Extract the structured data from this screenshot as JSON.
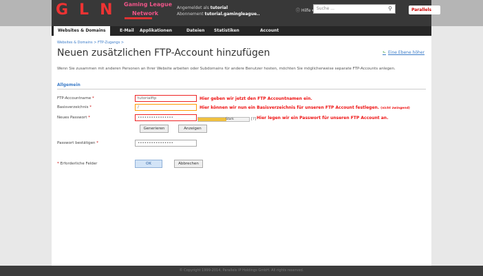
{
  "header": {
    "logo": "GLN",
    "logo_sub1": "Gaming League",
    "logo_sub2": "Network",
    "login_prefix": "Angemeldet als",
    "login_user": "tutorial",
    "login_sub_prefix": "Abonnement",
    "login_sub": "tutorial.gamingleague..",
    "help": "Hilfe",
    "search_placeholder": "Suche ...",
    "parallels": "Parallels"
  },
  "tabs": [
    "Websites & Domains",
    "E-Mail",
    "Applikationen",
    "Dateien",
    "Statistiken",
    "Account"
  ],
  "breadcrumb": "Websites & Domains > FTP-Zugangs >",
  "title": "Neuen zusätzlichen FTP-Account hinzufügen",
  "help_link": "Eine Ebene höher",
  "description": "Wenn Sie zusammen mit anderen Personen an Ihrer Website arbeiten oder Subdomains für andere Benutzer hosten, möchten Sie möglicherweise separate FTP-Accounts anlegen.",
  "section": "Allgemein",
  "form": {
    "ftp_name_label": "FTP-Accountname",
    "ftp_name_value": "tutorialftp",
    "home_label": "Basisverzeichnis",
    "home_value": "/",
    "password_label": "Neues Passwort",
    "password_value": "••••••••••••••••",
    "strength": "Stark",
    "confirm_label": "Passwort bestätigen",
    "confirm_value": "••••••••••••••••",
    "generate": "Generieren",
    "show": "Anzeigen",
    "required_note": "Erforderliche Felder",
    "ok": "OK",
    "cancel": "Abbrechen"
  },
  "notes": {
    "name": "Hier geben wir jetzt den FTP Accountnamen ein.",
    "home": "Hier können wir nun ein Basisverzeichnis für unseren FTP Account festlegen.",
    "home_small": "(nicht zwingend)",
    "password": "Hier legen wir ein Passwort für unseren FTP Account an."
  },
  "footer": "© Copyright 1999-2014, Parallels IP Holdings GmbH. All rights reserved.",
  "colors": {
    "accent": "#3a7bc8",
    "annotation": "#e11",
    "header": "#383838"
  },
  "password_strength_fraction": 0.55
}
